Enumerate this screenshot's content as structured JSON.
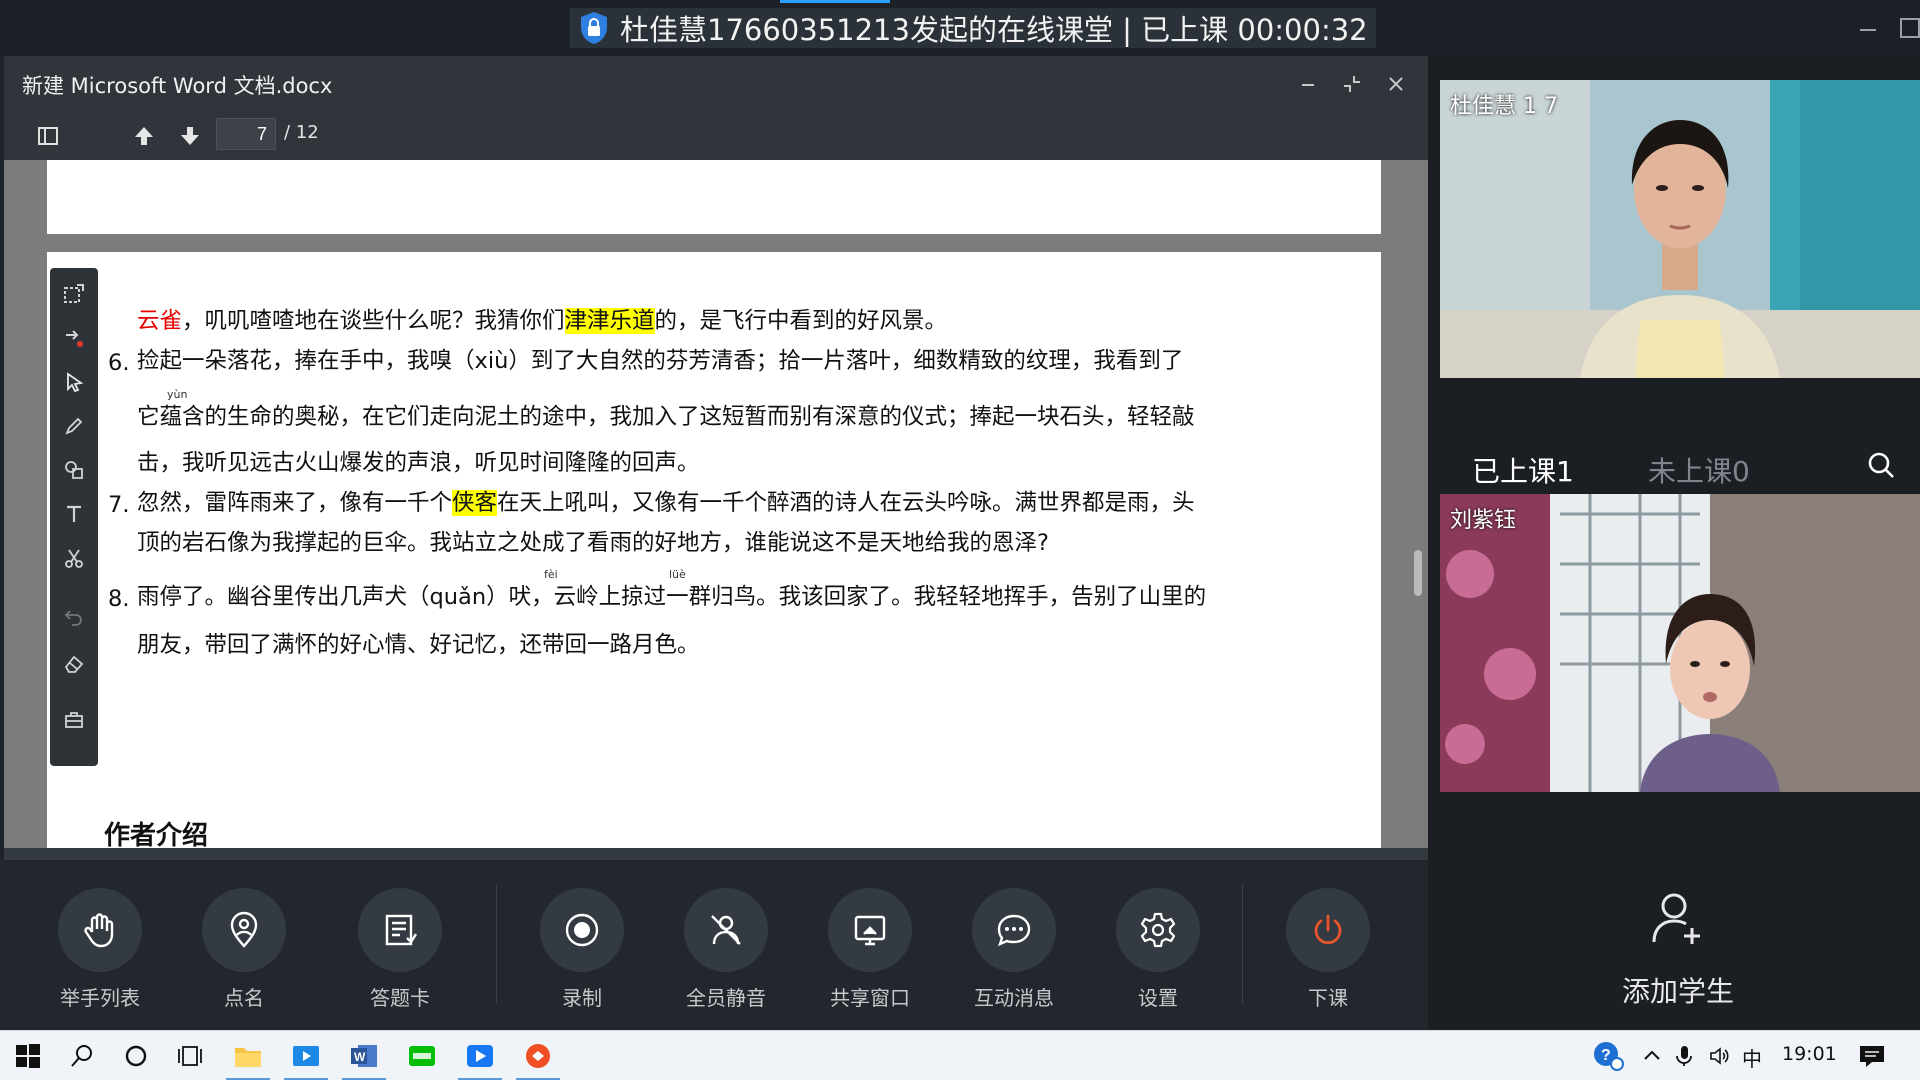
{
  "window": {
    "title": "杜佳慧17660351213发起的在线课堂 | 已上课 00:00:32"
  },
  "document": {
    "filename": "新建 Microsoft Word 文档.docx",
    "current_page": "7",
    "total_pages": "/ 12",
    "line_1": {
      "part_red": "云雀",
      "part_a": "，叽叽喳喳地在谈些什么呢？我猜你们",
      "part_highlight": "津津乐道",
      "part_b": "的，是飞行中看到的好风景。"
    },
    "item_6": {
      "number": "6.",
      "line1": "捡起一朵落花，捧在手中，我嗅（xiù）到了大自然的芬芳清香；拾一片落叶，细数精致的纹理，我看到了",
      "pinyin": "yùn",
      "line2": "它蕴含的生命的奥秘，在它们走向泥土的途中，我加入了这短暂而别有深意的仪式；捧起一块石头，轻轻敲",
      "line3": "击，我听见远古火山爆发的声浪，听见时间隆隆的回声。"
    },
    "item_7": {
      "number": "7.",
      "line1_a": "忽然，雷阵雨来了，像有一千个",
      "line1_highlight": "侠客",
      "line1_b": "在天上吼叫，又像有一千个醉酒的诗人在云头吟咏。满世界都是雨，头",
      "line2": "顶的岩石像为我撑起的巨伞。我站立之处成了看雨的好地方，谁能说这不是天地给我的恩泽?"
    },
    "item_8": {
      "number": "8.",
      "pinyin_1": "fèi",
      "pinyin_2": "lüè",
      "line1": "雨停了。幽谷里传出几声犬（quǎn）吠，云岭上掠过一群归鸟。我该回家了。我轻轻地挥手，告别了山里的",
      "line2": "朋友，带回了满怀的好心情、好记忆，还带回一路月色。"
    },
    "heading": "作者介绍"
  },
  "controls": [
    {
      "label": "举手列表",
      "icon": "hand-icon"
    },
    {
      "label": "点名",
      "icon": "location-pin-icon"
    },
    {
      "label": "答题卡",
      "icon": "answer-card-icon"
    },
    {
      "label": "录制",
      "icon": "record-icon"
    },
    {
      "label": "全员静音",
      "icon": "mute-all-icon"
    },
    {
      "label": "共享窗口",
      "icon": "share-window-icon"
    },
    {
      "label": "互动消息",
      "icon": "chat-bubble-icon"
    },
    {
      "label": "设置",
      "icon": "gear-icon"
    },
    {
      "label": "下课",
      "icon": "power-icon"
    }
  ],
  "participants": {
    "teacher": {
      "name": "杜佳慧 1 7"
    },
    "student": {
      "name": "刘紫钰"
    }
  },
  "tabs": {
    "attended": "已上课1",
    "not_attended": "未上课0"
  },
  "add_student": {
    "label": "添加学生"
  },
  "taskbar": {
    "ime": "中",
    "time": "19:01"
  },
  "colors": {
    "accent": "#2aa1ff",
    "highlight": "#ffff00",
    "red_text": "#e60000",
    "end_class": "#e8542c"
  }
}
